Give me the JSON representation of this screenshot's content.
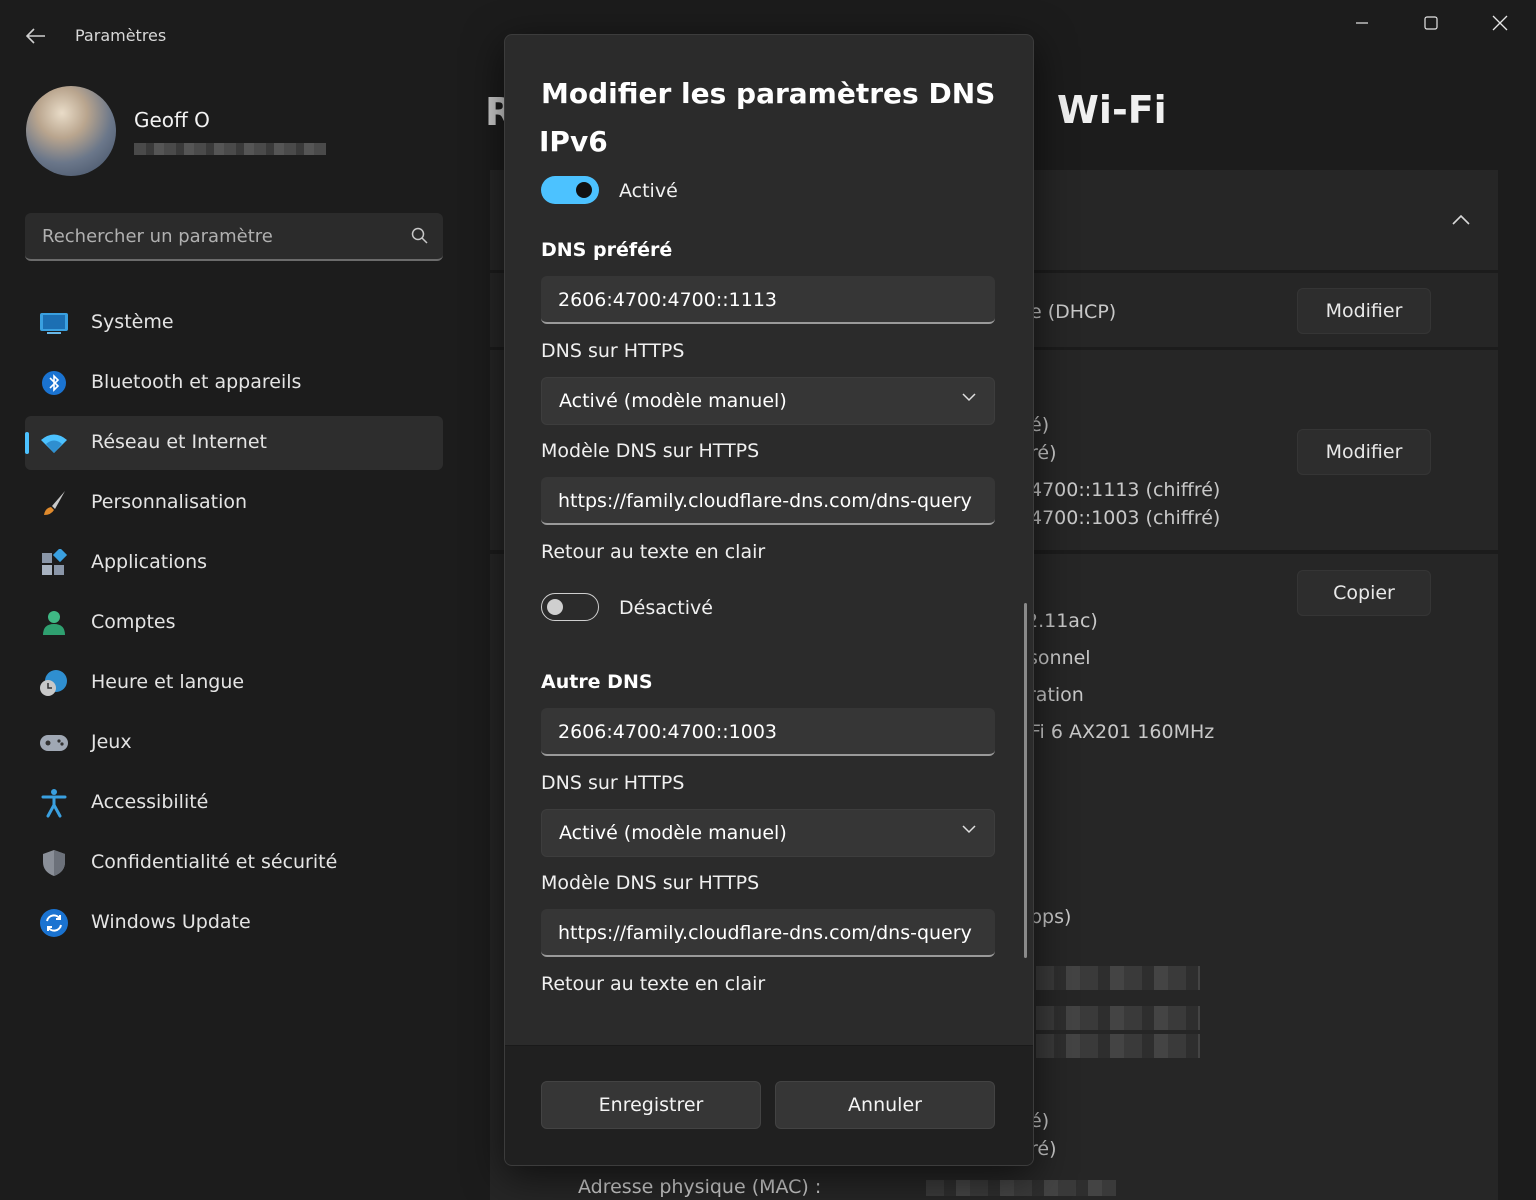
{
  "window": {
    "title": "Paramètres",
    "back_icon": "back-arrow-icon",
    "minimize_icon": "minimize-icon",
    "maximize_icon": "maximize-icon",
    "close_icon": "close-icon"
  },
  "user": {
    "name": "Geoff O"
  },
  "search": {
    "placeholder": "Rechercher un paramètre"
  },
  "sidebar": {
    "items": [
      {
        "label": "Système",
        "icon": "monitor-icon"
      },
      {
        "label": "Bluetooth et appareils",
        "icon": "bluetooth-icon"
      },
      {
        "label": "Réseau et Internet",
        "icon": "wifi-icon",
        "active": true
      },
      {
        "label": "Personnalisation",
        "icon": "brush-icon"
      },
      {
        "label": "Applications",
        "icon": "apps-icon"
      },
      {
        "label": "Comptes",
        "icon": "person-icon"
      },
      {
        "label": "Heure et langue",
        "icon": "clock-globe-icon"
      },
      {
        "label": "Jeux",
        "icon": "gamepad-icon"
      },
      {
        "label": "Accessibilité",
        "icon": "accessibility-icon"
      },
      {
        "label": "Confidentialité et sécurité",
        "icon": "shield-icon"
      },
      {
        "label": "Windows Update",
        "icon": "update-icon"
      }
    ]
  },
  "background": {
    "title_fragment": "R",
    "title_wifi": "Wi-Fi",
    "dhcp_fragment": "e (DHCP)",
    "modify_button": "Modifier",
    "modify_button_2": "Modifier",
    "copy_button": "Copier",
    "dns_frag_1": "é)",
    "dns_frag_2": "ré)",
    "dns_frag_3": "4700::1113 (chiffré)",
    "dns_frag_4": "4700::1003 (chiffré)",
    "frag_11ac": "2.11ac)",
    "frag_sonnel": "sonnel",
    "frag_ration": "ration",
    "frag_adapter": "Fi 6 AX201 160MHz",
    "frag_bps": "bps)",
    "frag_e1": "é)",
    "frag_e2": "ré)",
    "mac_label": "Adresse physique (MAC) :"
  },
  "dialog": {
    "title": "Modifier les paramètres DNS",
    "ipv6_heading": "IPv6",
    "ipv6_toggle": {
      "label": "Activé",
      "on": true
    },
    "preferred": {
      "heading": "DNS préféré",
      "address": "2606:4700:4700::1113",
      "doh_label": "DNS sur HTTPS",
      "doh_value": "Activé (modèle manuel)",
      "template_label": "Modèle DNS sur HTTPS",
      "template_value": "https://family.cloudflare-dns.com/dns-query",
      "fallback_label": "Retour au texte en clair",
      "fallback_toggle": {
        "label": "Désactivé",
        "on": false
      }
    },
    "alternate": {
      "heading": "Autre DNS",
      "address": "2606:4700:4700::1003",
      "doh_label": "DNS sur HTTPS",
      "doh_value": "Activé (modèle manuel)",
      "template_label": "Modèle DNS sur HTTPS",
      "template_value": "https://family.cloudflare-dns.com/dns-query",
      "fallback_label": "Retour au texte en clair"
    },
    "save_button": "Enregistrer",
    "cancel_button": "Annuler"
  },
  "colors": {
    "accent": "#4cc2ff",
    "background": "#1c1c1c",
    "dialog": "#2b2b2b"
  }
}
